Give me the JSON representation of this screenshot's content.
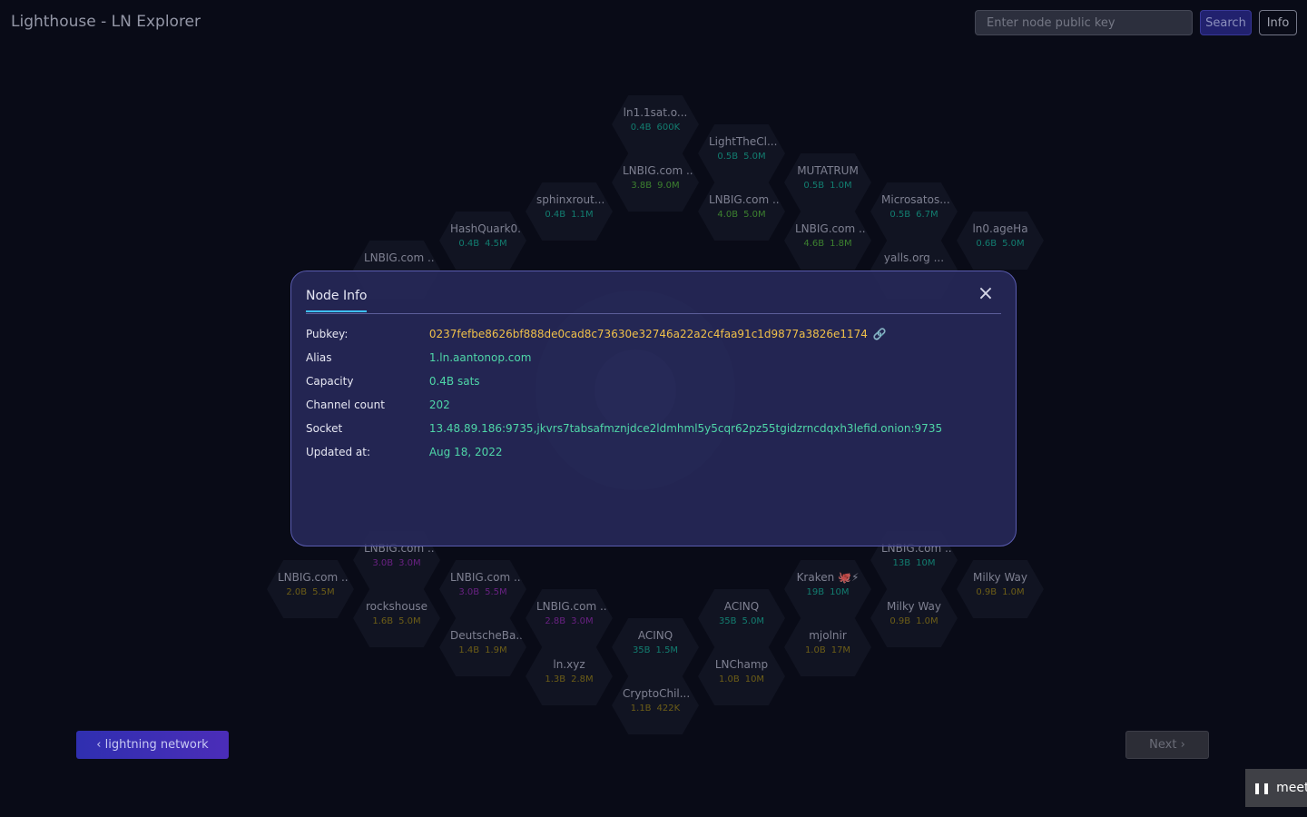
{
  "header": {
    "title": "Lighthouse - LN Explorer",
    "search_placeholder": "Enter node public key",
    "search_label": "Search",
    "info_label": "Info"
  },
  "hexes": [
    {
      "alias": "ln1.1sat.o...",
      "cap": "0.4B",
      "count": "600K",
      "color": "#17a38f"
    },
    {
      "alias": "LightTheCl...",
      "cap": "0.5B",
      "count": "5.0M",
      "color": "#17a38f"
    },
    {
      "alias": "LNBIG.com ...",
      "cap": "3.8B",
      "count": "9.0M",
      "color": "#4fa83a"
    },
    {
      "alias": "MUTATRUM",
      "cap": "0.5B",
      "count": "1.0M",
      "color": "#17a38f"
    },
    {
      "alias": "sphinxrout...",
      "cap": "0.4B",
      "count": "1.1M",
      "color": "#17a38f"
    },
    {
      "alias": "LNBIG.com ...",
      "cap": "4.0B",
      "count": "5.0M",
      "color": "#4fa83a"
    },
    {
      "alias": "Microsatos...",
      "cap": "0.5B",
      "count": "6.7M",
      "color": "#17a38f"
    },
    {
      "alias": "HashQuark0...",
      "cap": "0.4B",
      "count": "4.5M",
      "color": "#17a38f"
    },
    {
      "alias": "LNBIG.com ...",
      "cap": "4.6B",
      "count": "1.8M",
      "color": "#4fa83a"
    },
    {
      "alias": "ln0.ageHa",
      "cap": "0.6B",
      "count": "5.0M",
      "color": "#17a38f"
    },
    {
      "alias": "LNBIG.com ...",
      "cap": "",
      "count": "",
      "color": "#17a38f"
    },
    {
      "alias": "yalls.org ...",
      "cap": "",
      "count": "",
      "color": "#17a38f"
    },
    {
      "alias": "LNBIG.com ...",
      "cap": "3.0B",
      "count": "3.0M",
      "color": "#8a2aa8"
    },
    {
      "alias": "LNBIG.com ...",
      "cap": "13B",
      "count": "10M",
      "color": "#17a38f"
    },
    {
      "alias": "LNBIG.com ...",
      "cap": "2.0B",
      "count": "5.5M",
      "color": "#8f7a1a"
    },
    {
      "alias": "LNBIG.com ...",
      "cap": "3.0B",
      "count": "5.5M",
      "color": "#8a2aa8"
    },
    {
      "alias": "Kraken 🐙⚡",
      "cap": "19B",
      "count": "10M",
      "color": "#17a38f"
    },
    {
      "alias": "Milky Way",
      "cap": "0.9B",
      "count": "1.0M",
      "color": "#8f7a1a"
    },
    {
      "alias": "rockshouse",
      "cap": "1.6B",
      "count": "5.0M",
      "color": "#8f7a1a"
    },
    {
      "alias": "LNBIG.com ...",
      "cap": "2.8B",
      "count": "3.0M",
      "color": "#8a2aa8"
    },
    {
      "alias": "ACINQ",
      "cap": "35B",
      "count": "5.0M",
      "color": "#17a38f"
    },
    {
      "alias": "Milky Way",
      "cap": "0.9B",
      "count": "1.0M",
      "color": "#8f7a1a"
    },
    {
      "alias": "DeutscheBa...",
      "cap": "1.4B",
      "count": "1.9M",
      "color": "#8f7a1a"
    },
    {
      "alias": "ACINQ",
      "cap": "35B",
      "count": "1.5M",
      "color": "#17a38f"
    },
    {
      "alias": "mjolnir",
      "cap": "1.0B",
      "count": "17M",
      "color": "#8f7a1a"
    },
    {
      "alias": "ln.xyz",
      "cap": "1.3B",
      "count": "2.8M",
      "color": "#8f7a1a"
    },
    {
      "alias": "LNChamp",
      "cap": "1.0B",
      "count": "10M",
      "color": "#8f7a1a"
    },
    {
      "alias": "CryptoChil...",
      "cap": "1.1B",
      "count": "422K",
      "color": "#8f7a1a"
    }
  ],
  "modal": {
    "title": "Node Info",
    "close_symbol": "×",
    "link_icon": "🔗",
    "rows": [
      {
        "label": "Pubkey:",
        "value": "0237fefbe8626bf888de0cad8c73630e32746a22a2c4faa91c1d9877a3826e1174"
      },
      {
        "label": "Alias",
        "value": "1.ln.aantonop.com"
      },
      {
        "label": "Capacity",
        "value": "0.4B sats"
      },
      {
        "label": "Channel count",
        "value": "202"
      },
      {
        "label": "Socket",
        "value": "13.48.89.186:9735,jkvrs7tabsafmznjdce2ldmhml5y5cqr62pz55tgidzrncdqxh3lefid.onion:9735"
      },
      {
        "label": "Updated at:",
        "value": "Aug 18, 2022"
      }
    ]
  },
  "footer": {
    "back_label": "lightning network",
    "next_label": "Next",
    "meet_label": "meet.g"
  },
  "colors": {
    "background": "#0b0d1a",
    "accent": "#3ec0ff",
    "value_green": "#4fd6a8",
    "pubkey_yellow": "#f0c04a"
  }
}
